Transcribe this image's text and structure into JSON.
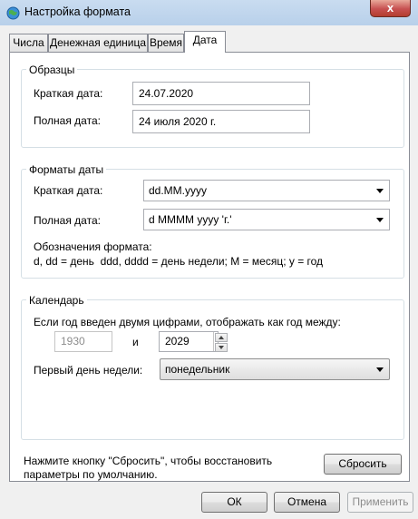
{
  "window": {
    "title": "Настройка формата",
    "close_glyph": "x"
  },
  "tabs": [
    {
      "label": "Числа"
    },
    {
      "label": "Денежная единица"
    },
    {
      "label": "Время"
    },
    {
      "label": "Дата",
      "active": true
    }
  ],
  "samples": {
    "legend": "Образцы",
    "short_label": "Краткая дата:",
    "short_value": "24.07.2020",
    "long_label": "Полная дата:",
    "long_value": "24 июля 2020 г."
  },
  "formats": {
    "legend": "Форматы даты",
    "short_label": "Краткая дата:",
    "short_value": "dd.MM.yyyy",
    "long_label": "Полная дата:",
    "long_value": "d MMMM yyyy 'г.'",
    "notation_title": "Обозначения формата:",
    "notation_text": "d, dd = день  ddd, dddd = день недели; M = месяц; y = год"
  },
  "calendar": {
    "legend": "Календарь",
    "two_digit_label": "Если год введен двумя цифрами, отображать как год между:",
    "year_from": "1930",
    "and_label": "и",
    "year_to": "2029",
    "first_day_label": "Первый день недели:",
    "first_day_value": "понедельник"
  },
  "reset": {
    "hint": "Нажмите кнопку \"Сбросить\", чтобы восстановить параметры по умолчанию.",
    "button": "Сбросить"
  },
  "footer": {
    "ok": "ОК",
    "cancel": "Отмена",
    "apply": "Применить"
  }
}
